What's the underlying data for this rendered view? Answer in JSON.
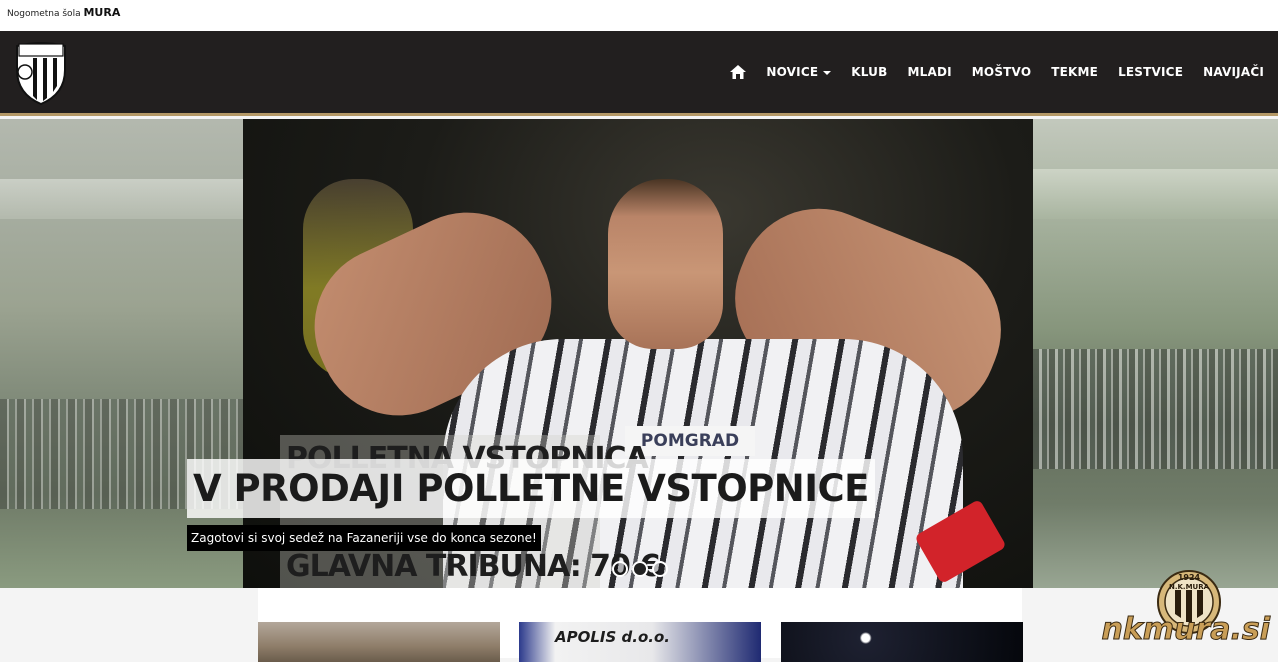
{
  "topbar": {
    "school_prefix": "Nogometna šola",
    "school_name": "MURA"
  },
  "logo": {
    "text": "NŠ MURA"
  },
  "nav": {
    "home_icon": "home-icon",
    "items": [
      "NOVICE",
      "KLUB",
      "MLADI",
      "MOŠTVO",
      "TEKME",
      "LESTVICE",
      "NAVIJAČI"
    ]
  },
  "hero": {
    "poster_line1": "POLLETNA VSTOPNICA",
    "poster_line2": "GLAVNA TRIBUNA: 70 €",
    "sponsor": "POMGRAD",
    "title": "V PRODAJI POLLETNE VSTOPNICE",
    "subtitle": "Zagotovi si svoj sedež na Fazaneriji vse do konca sezone!",
    "slides": 3,
    "active_slide": 2
  },
  "cards": {
    "card2_text": "APOLIS d.o.o."
  },
  "watermark": {
    "year": "1924",
    "club": "N.K.MURA",
    "site": "nkmura.si"
  },
  "colors": {
    "navbar": "#221f1f",
    "accent": "#b49866",
    "watermark": "#c99e57"
  }
}
